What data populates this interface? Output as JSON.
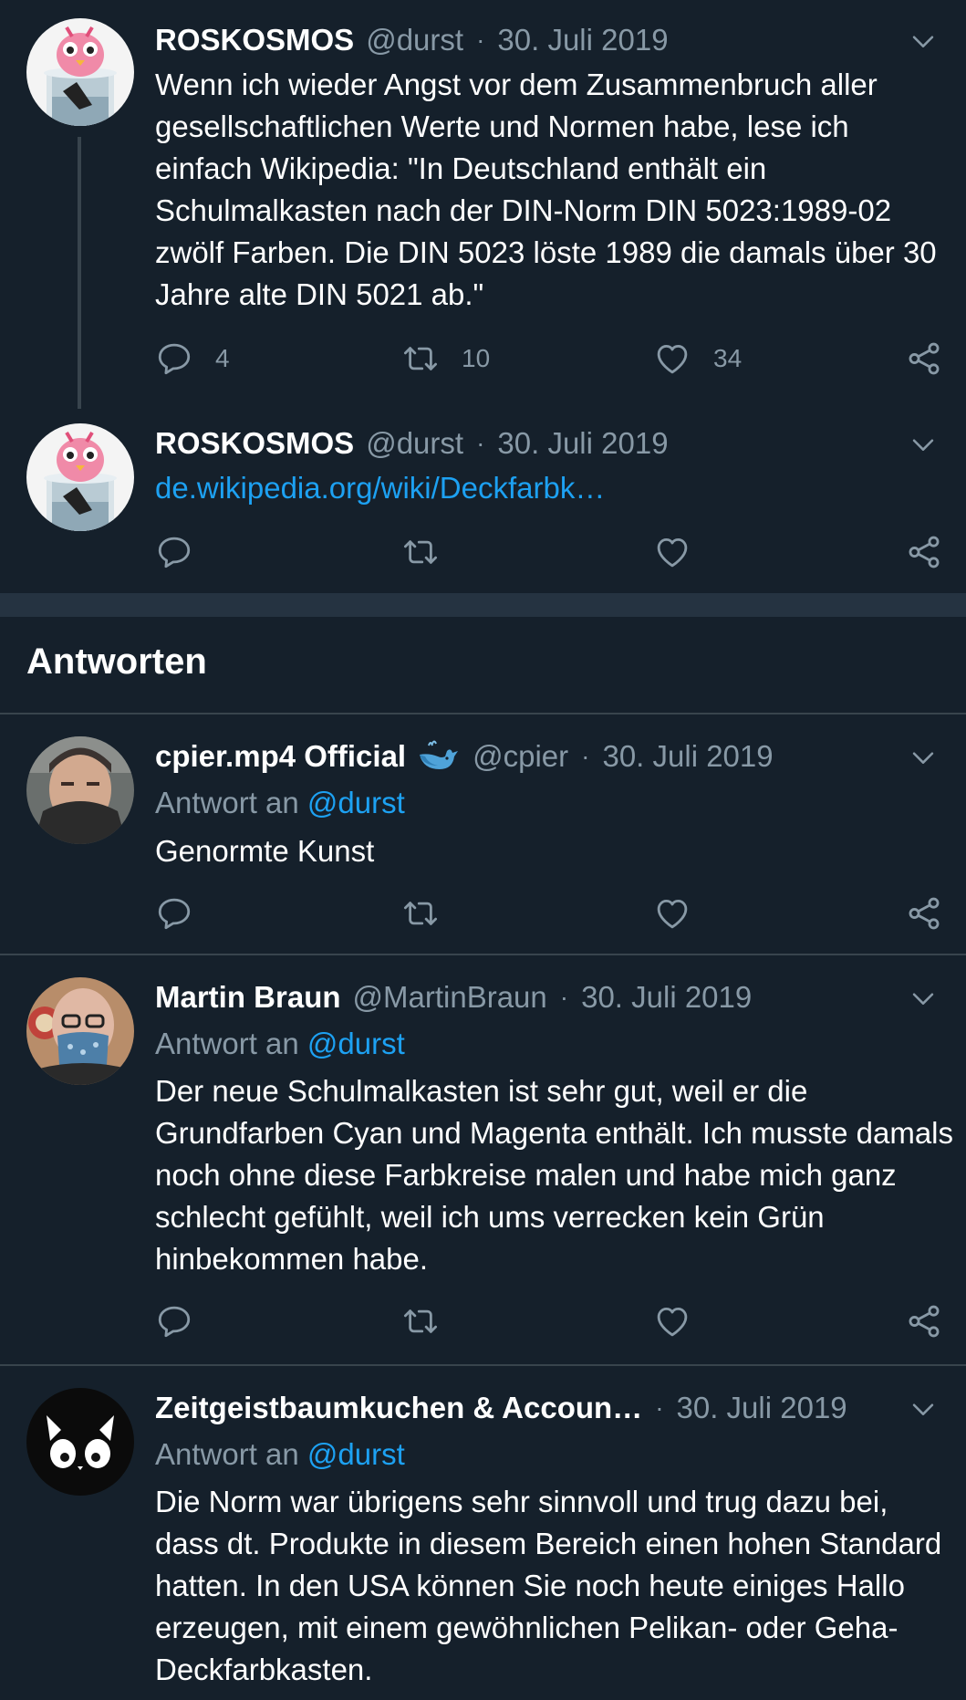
{
  "tweets": [
    {
      "name": "ROSKOSMOS",
      "handle": "@durst",
      "date": "30. Juli 2019",
      "text": "Wenn ich wieder Angst vor dem Zusammenbruch aller gesellschaftlichen Werte und Normen habe, lese ich einfach Wikipedia: \"In Deutschland enthält ein Schulmalkasten nach der DIN-Norm DIN 5023:1989-02 zwölf Farben. Die DIN 5023 löste 1989 die damals über 30 Jahre alte DIN 5021 ab.\"",
      "replies": "4",
      "retweets": "10",
      "likes": "34"
    },
    {
      "name": "ROSKOSMOS",
      "handle": "@durst",
      "date": "30. Juli 2019",
      "link": "de.wikipedia.org/wiki/Deckfarbk…"
    }
  ],
  "replies_section": {
    "title": "Antworten",
    "reply_prefix": "Antwort an",
    "items": [
      {
        "name": "cpier.mp4 Official",
        "handle": "@cpier",
        "date": "30. Juli 2019",
        "reply_to": "@durst",
        "text": "Genormte Kunst"
      },
      {
        "name": "Martin Braun",
        "handle": "@MartinBraun",
        "date": "30. Juli 2019",
        "reply_to": "@durst",
        "text": "Der neue Schulmalkasten ist sehr gut, weil er die Grundfarben Cyan und Magenta enthält. Ich musste damals noch ohne diese Farbkreise malen und habe mich ganz schlecht gefühlt, weil ich ums verrecken kein Grün hinbekommen habe."
      },
      {
        "name": "Zeitgeistbaumkuchen & Accoun…",
        "handle": "",
        "date": "30. Juli 2019",
        "reply_to": "@durst",
        "text": "Die Norm war übrigens sehr sinnvoll und trug dazu bei, dass dt. Produkte in diesem Bereich einen hohen Standard hatten. In den USA können Sie noch heute einiges Hallo erzeugen, mit einem gewöhnlichen Pelikan- oder Geha-Deckfarbkasten."
      }
    ]
  },
  "separator": "·",
  "icons": {
    "reply": "reply-icon",
    "retweet": "retweet-icon",
    "like": "heart-icon",
    "share": "share-icon",
    "menu": "chevron-down-icon",
    "badge": "whale-icon"
  },
  "colors": {
    "background": "#15202b",
    "text": "#ffffff",
    "muted": "#8899a6",
    "accent": "#1da1f2",
    "divider": "#38444d"
  }
}
